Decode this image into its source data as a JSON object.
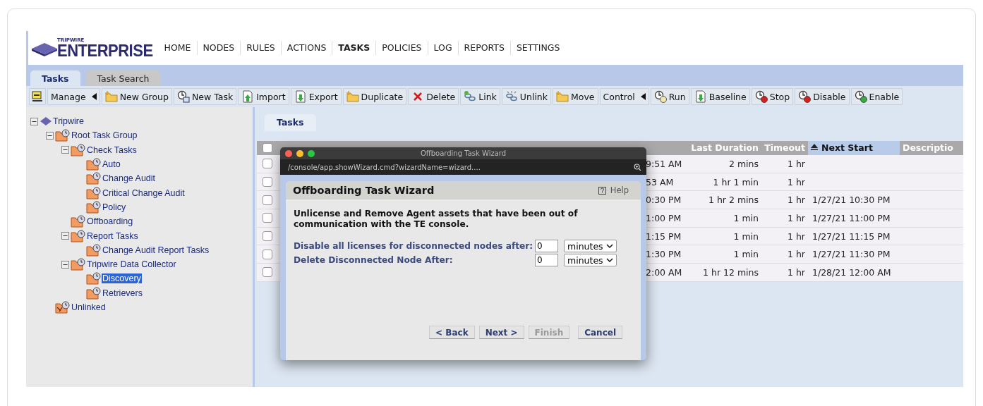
{
  "logo": {
    "small": "TRIPWIRE",
    "large": "ENTERPRISE"
  },
  "nav": [
    {
      "label": "HOME",
      "selected": false
    },
    {
      "label": "NODES",
      "selected": false
    },
    {
      "label": "RULES",
      "selected": false
    },
    {
      "label": "ACTIONS",
      "selected": false
    },
    {
      "label": "TASKS",
      "selected": true
    },
    {
      "label": "POLICIES",
      "selected": false
    },
    {
      "label": "LOG",
      "selected": false
    },
    {
      "label": "REPORTS",
      "selected": false
    },
    {
      "label": "SETTINGS",
      "selected": false
    }
  ],
  "tabs": [
    {
      "label": "Tasks",
      "selected": true
    },
    {
      "label": "Task Search",
      "selected": false
    }
  ],
  "toolbar": [
    {
      "kind": "toggle"
    },
    {
      "kind": "menu",
      "label": "Manage"
    },
    {
      "kind": "button",
      "label": "New Group"
    },
    {
      "kind": "button",
      "label": "New Task"
    },
    {
      "kind": "button",
      "label": "Import"
    },
    {
      "kind": "button",
      "label": "Export"
    },
    {
      "kind": "button",
      "label": "Duplicate"
    },
    {
      "kind": "button",
      "label": "Delete"
    },
    {
      "kind": "button",
      "label": "Link"
    },
    {
      "kind": "button",
      "label": "Unlink"
    },
    {
      "kind": "button",
      "label": "Move"
    },
    {
      "kind": "menu",
      "label": "Control"
    },
    {
      "kind": "button",
      "label": "Run"
    },
    {
      "kind": "button",
      "label": "Baseline"
    },
    {
      "kind": "button",
      "label": "Stop"
    },
    {
      "kind": "button",
      "label": "Disable"
    },
    {
      "kind": "button",
      "label": "Enable"
    }
  ],
  "tree": [
    {
      "label": "Tripwire",
      "kind": "root",
      "selected": false,
      "expanded": true,
      "children": [
        {
          "label": "Root Task Group",
          "kind": "group",
          "selected": false,
          "expanded": true,
          "children": [
            {
              "label": "Check Tasks",
              "kind": "group",
              "selected": false,
              "expanded": true,
              "children": [
                {
                  "label": "Auto",
                  "kind": "group",
                  "selected": false
                },
                {
                  "label": "Change Audit",
                  "kind": "group",
                  "selected": false
                },
                {
                  "label": "Critical Change Audit",
                  "kind": "group",
                  "selected": false
                },
                {
                  "label": "Policy",
                  "kind": "group",
                  "selected": false
                }
              ]
            },
            {
              "label": "Offboarding",
              "kind": "group",
              "selected": false
            },
            {
              "label": "Report Tasks",
              "kind": "group",
              "selected": false,
              "expanded": true,
              "children": [
                {
                  "label": "Change Audit Report Tasks",
                  "kind": "group",
                  "selected": false
                }
              ]
            },
            {
              "label": "Tripwire Data Collector",
              "kind": "group",
              "selected": false,
              "expanded": true,
              "children": [
                {
                  "label": "Discovery",
                  "kind": "group",
                  "selected": true
                },
                {
                  "label": "Retrievers",
                  "kind": "group",
                  "selected": false
                }
              ]
            }
          ]
        },
        {
          "label": "Unlinked",
          "kind": "unlinked",
          "selected": false
        }
      ]
    }
  ],
  "panel_tabs": [
    {
      "label": "Tasks",
      "selected": true
    }
  ],
  "table": {
    "header_checkbox": {
      "checked": false
    },
    "columns": [
      {
        "label": "Last Duration",
        "sorted": false
      },
      {
        "label": "Timeout",
        "sorted": false
      },
      {
        "label": "Next Start",
        "sorted": true
      },
      {
        "label": "Descriptio",
        "sorted": false
      }
    ],
    "rows": [
      {
        "checked": false,
        "last_start": "9:51 AM",
        "last_duration": "2 mins",
        "timeout": "1 hr",
        "next_start": ""
      },
      {
        "checked": false,
        "last_start": "53 AM",
        "last_duration": "1 hr 1 min",
        "timeout": "1 hr",
        "next_start": ""
      },
      {
        "checked": false,
        "last_start": "0:30 PM",
        "last_duration": "1 hr 2 mins",
        "timeout": "1 hr",
        "next_start": "1/27/21 10:30 PM"
      },
      {
        "checked": false,
        "last_start": "1:00 PM",
        "last_duration": "1 min",
        "timeout": "1 hr",
        "next_start": "1/27/21 11:00 PM"
      },
      {
        "checked": false,
        "last_start": "1:15 PM",
        "last_duration": "1 min",
        "timeout": "1 hr",
        "next_start": "1/27/21 11:15 PM"
      },
      {
        "checked": false,
        "last_start": "1:30 PM",
        "last_duration": "1 min",
        "timeout": "1 hr",
        "next_start": "1/27/21 11:30 PM"
      },
      {
        "checked": false,
        "last_start": "2:00 AM",
        "last_duration": "1 hr 12 mins",
        "timeout": "1 hr",
        "next_start": "1/28/21 12:00 AM"
      }
    ]
  },
  "wizard": {
    "window_title": "Offboarding Task Wizard",
    "url": "/console/app.showWizard.cmd?wizardName=wizard....",
    "title": "Offboarding Task Wizard",
    "help": "Help",
    "description": "Unlicense and Remove Agent assets that have been out of communication with the TE console.",
    "fields": [
      {
        "label": "Disable all licenses for disconnected nodes after:",
        "value": "0",
        "unit": "minutes"
      },
      {
        "label": "Delete Disconnected Node After:",
        "value": "0",
        "unit": "minutes"
      }
    ],
    "buttons": [
      {
        "label": "< Back",
        "disabled": false
      },
      {
        "label": "Next >",
        "disabled": false
      },
      {
        "label": "Finish",
        "disabled": true
      },
      {
        "label": "Cancel",
        "disabled": false
      }
    ]
  }
}
